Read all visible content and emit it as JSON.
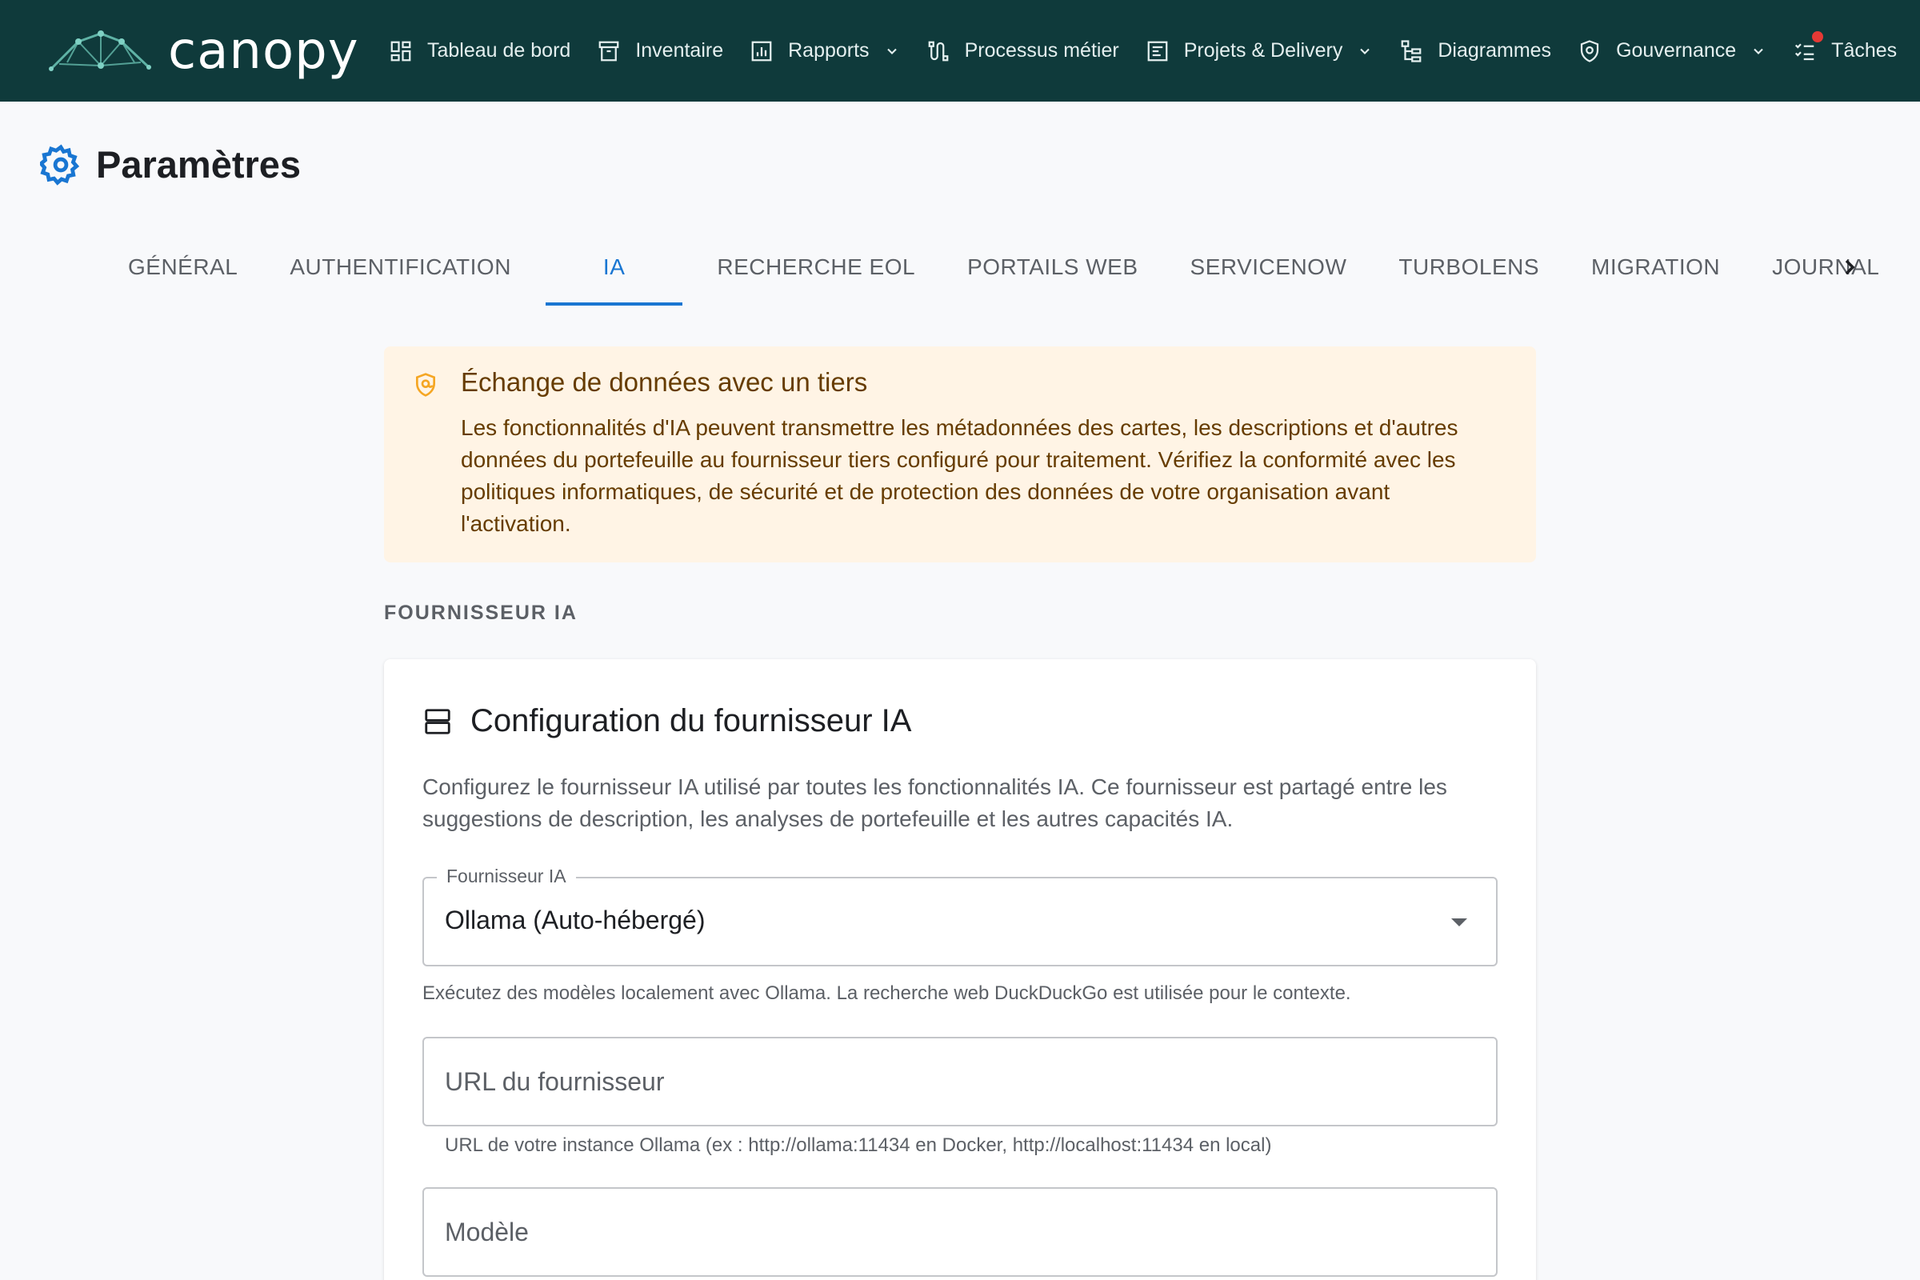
{
  "brand": {
    "name": "canopy"
  },
  "nav": [
    {
      "label": "Tableau de bord",
      "icon": "dashboard-icon",
      "dropdown": false
    },
    {
      "label": "Inventaire",
      "icon": "archive-icon",
      "dropdown": false
    },
    {
      "label": "Rapports",
      "icon": "bar-chart-icon",
      "dropdown": true
    },
    {
      "label": "Processus métier",
      "icon": "process-icon",
      "dropdown": false
    },
    {
      "label": "Projets & Delivery",
      "icon": "project-icon",
      "dropdown": true
    },
    {
      "label": "Diagrammes",
      "icon": "diagram-icon",
      "dropdown": false
    },
    {
      "label": "Gouvernance",
      "icon": "shield-icon",
      "dropdown": true
    },
    {
      "label": "Tâches",
      "icon": "tasks-icon",
      "dropdown": false
    }
  ],
  "page": {
    "title": "Paramètres"
  },
  "tabs": [
    {
      "label": "Général"
    },
    {
      "label": "Authentification"
    },
    {
      "label": "IA",
      "active": true
    },
    {
      "label": "Recherche EOL"
    },
    {
      "label": "Portails web"
    },
    {
      "label": "ServiceNow"
    },
    {
      "label": "TurboLens"
    },
    {
      "label": "Migration"
    },
    {
      "label": "Journal"
    }
  ],
  "warning": {
    "title": "Échange de données avec un tiers",
    "text": "Les fonctionnalités d'IA peuvent transmettre les métadonnées des cartes, les descriptions et d'autres données du portefeuille au fournisseur tiers configuré pour traitement. Vérifiez la conformité avec les politiques informatiques, de sécurité et de protection des données de votre organisation avant l'activation.",
    "color": "#663c00",
    "background": "#fff4e5"
  },
  "section": {
    "label": "Fournisseur IA"
  },
  "card": {
    "title": "Configuration du fournisseur IA",
    "description": "Configurez le fournisseur IA utilisé par toutes les fonctionnalités IA. Ce fournisseur est partagé entre les suggestions de description, les analyses de portefeuille et les autres capacités IA.",
    "provider_select": {
      "label": "Fournisseur IA",
      "value": "Ollama (Auto-hébergé)",
      "helper": "Exécutez des modèles localement avec Ollama. La recherche web DuckDuckGo est utilisée pour le contexte."
    },
    "url_field": {
      "placeholder": "URL du fournisseur",
      "helper": "URL de votre instance Ollama (ex : http://ollama:11434 en Docker, http://localhost:11434 en local)"
    },
    "model_field": {
      "placeholder": "Modèle"
    }
  },
  "colors": {
    "topbar": "#0f3a3b",
    "accent": "#1976d2",
    "notification": "#e53935",
    "warning_icon": "#f5a623"
  }
}
